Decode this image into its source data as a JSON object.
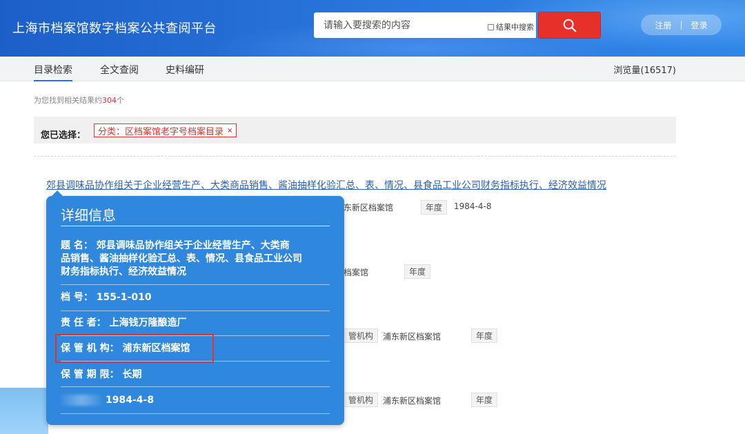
{
  "header": {
    "site_title": "上海市档案馆数字档案公共查阅平台",
    "search_placeholder": "请输入要搜索的内容",
    "in_result_label": "结果中搜索",
    "register": "注册",
    "separator": "|",
    "login": "登录"
  },
  "nav": {
    "items": [
      "目录检索",
      "全文查阅",
      "史料编研"
    ],
    "views_label": "浏览量(16517)"
  },
  "results": {
    "prefix": "为您找到相关结果约",
    "count": "304",
    "suffix": "个"
  },
  "filter": {
    "label": "您已选择：",
    "tag": "分类：区档案馆老字号档案目录",
    "remove": "×"
  },
  "record": {
    "title": "郊县调味品协作组关于企业经营生产、大类商品销售、酱油抽样化验汇总、表、情况、县食品工业公司财务指标执行、经济效益情况",
    "frag1": "东新区档案馆",
    "frag1_year_tag": "年度",
    "frag1_date": "1984-4-8",
    "frag2": "档案馆",
    "frag2_year_tag": "年度",
    "frag3_tag": "管机构",
    "frag3": "浦东新区档案馆",
    "frag3_year_tag": "年度",
    "frag4_tag": "管机构",
    "frag4": "浦东新区档案馆",
    "frag4_year_tag": "年度"
  },
  "popup": {
    "heading": "详细信息",
    "title_line1": "题 名： 郊县调味品协作组关于企业经营生产、大类商",
    "title_line2": "品销售、酱油抽样化验汇总、表、情况、县食品工业公司",
    "title_line3": "财务指标执行、经济效益情况",
    "archive_no": "档 号： 155-1-010",
    "responsible": "责 任 者： 上海钱万隆酿造厂",
    "custodian": "保 管 机 构： 浦东新区档案馆",
    "retention": "保 管 期 限： 长期",
    "date_value": "1984-4-8"
  },
  "colors": {
    "header_blue": "#2a78df",
    "popup_blue": "#2f88dd",
    "accent_red": "#e2322c",
    "link_blue": "#2b5fb0"
  }
}
